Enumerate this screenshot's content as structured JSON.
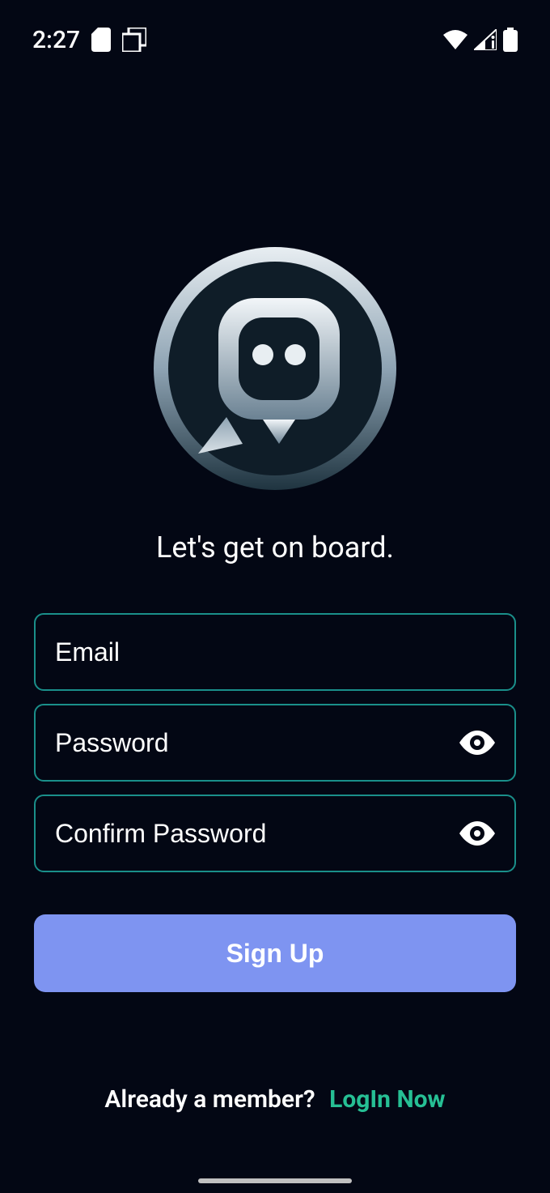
{
  "status_bar": {
    "time": "2:27"
  },
  "headline": "Let's get on board.",
  "form": {
    "email_placeholder": "Email",
    "password_placeholder": "Password",
    "confirm_password_placeholder": "Confirm Password",
    "signup_label": "Sign Up"
  },
  "footer": {
    "prompt": "Already a member?",
    "link_label": "LogIn Now"
  }
}
